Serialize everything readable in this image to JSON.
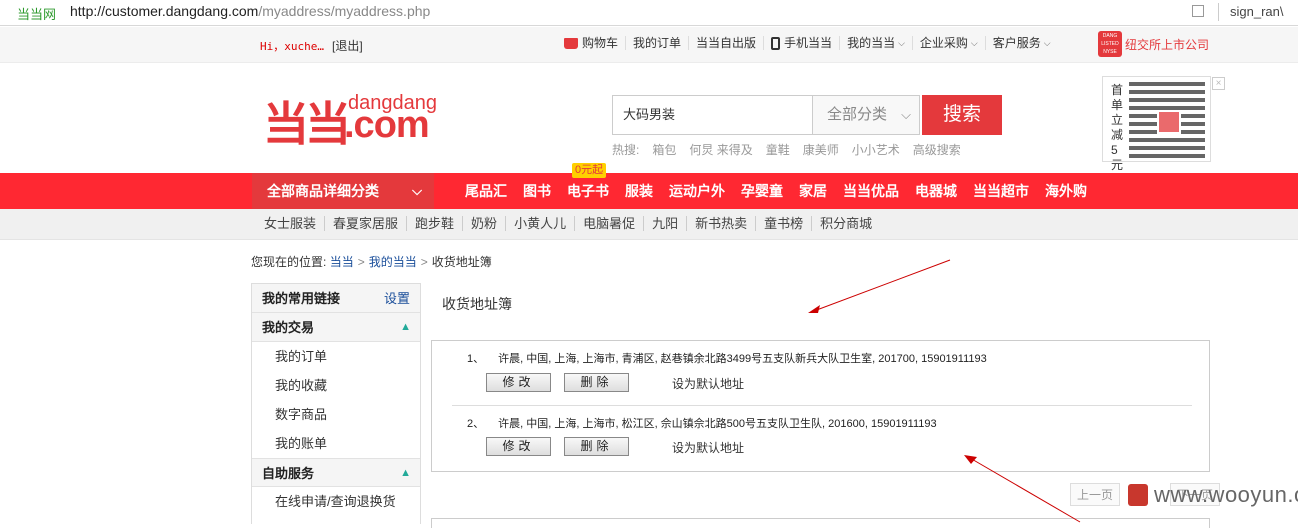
{
  "browser": {
    "site_name": "当当网",
    "url_host": "http://customer.dangdang.com",
    "url_path": "/myaddress/myaddress.php",
    "user": "sign_ran\\"
  },
  "topbar": {
    "greeting": "Hi，xuche…",
    "logout": "[退出]",
    "links": [
      {
        "label": "购物车",
        "icon": "cart-icon"
      },
      {
        "label": "我的订单"
      },
      {
        "label": "当当自出版"
      },
      {
        "label": "手机当当",
        "icon": "phone-icon"
      },
      {
        "label": "我的当当",
        "dropdown": true
      },
      {
        "label": "企业采购",
        "dropdown": true
      },
      {
        "label": "客户服务",
        "dropdown": true
      }
    ],
    "nyse_badge": "DANG LISTED NYSE",
    "nyse_text": "纽交所上市公司"
  },
  "header": {
    "logo_mark": "当当",
    "logo_dangdang": "dangdang",
    "logo_com": ".com",
    "search": {
      "value": "大码男装",
      "category": "全部分类",
      "button": "搜索"
    },
    "hot": {
      "label": "热搜:",
      "items": [
        "箱包",
        "何炅 来得及",
        "童鞋",
        "康美师",
        "小小艺术",
        "高级搜索"
      ]
    },
    "qr": {
      "side_text": "首单立减5元"
    }
  },
  "mainnav": {
    "all_categories": "全部商品详细分类",
    "badge": "0元起",
    "items": [
      "尾品汇",
      "图书",
      "电子书",
      "服装",
      "运动户外",
      "孕婴童",
      "家居",
      "当当优品",
      "电器城",
      "当当超市",
      "海外购"
    ]
  },
  "subnav": {
    "items": [
      "女士服装",
      "春夏家居服",
      "跑步鞋",
      "奶粉",
      "小黄人儿",
      "电脑暑促",
      "九阳",
      "新书热卖",
      "童书榜",
      "积分商城"
    ]
  },
  "breadcrumb": {
    "prefix": "您现在的位置:",
    "links": [
      "当当",
      "我的当当"
    ],
    "current": "收货地址簿"
  },
  "sidebar": {
    "sections": [
      {
        "title": "我的常用链接",
        "action": "设置",
        "items": []
      },
      {
        "title": "我的交易",
        "collapsible": true,
        "items": [
          "我的订单",
          "我的收藏",
          "数字商品",
          "我的账单"
        ]
      },
      {
        "title": "自助服务",
        "collapsible": true,
        "items": [
          "在线申请/查询退换货"
        ]
      }
    ]
  },
  "content": {
    "title": "收货地址簿",
    "addresses": [
      {
        "index": "1、",
        "text": "许晨, 中国, 上海, 上海市, 青浦区, 赵巷镇余北路3499号五支队新兵大队卫生室, 201700, 15901911193",
        "edit": "修改",
        "delete": "删除",
        "set_default": "设为默认地址"
      },
      {
        "index": "2、",
        "text": "许晨, 中国, 上海, 上海市, 松江区, 佘山镇佘北路500号五支队卫生队, 201600, 15901911193",
        "edit": "修改",
        "delete": "删除",
        "set_default": "设为默认地址"
      }
    ],
    "pager": {
      "prev": "上一页",
      "next": "下一页"
    }
  },
  "watermark": "www.wooyun.org",
  "colors": {
    "brand_red": "#e4393c",
    "nav_red": "#ff2832"
  }
}
